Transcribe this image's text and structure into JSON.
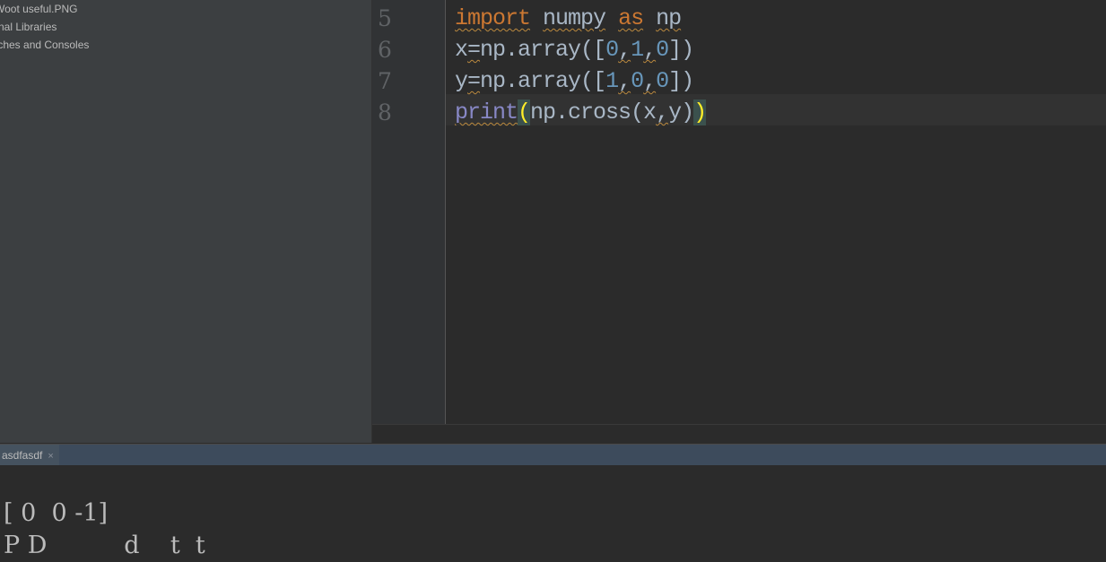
{
  "project_tree": {
    "items": [
      {
        "label": "Woot useful.PNG"
      },
      {
        "label": "rnal Libraries"
      },
      {
        "label": "tches and Consoles"
      }
    ]
  },
  "editor": {
    "line_numbers": [
      "5",
      "6",
      "7",
      "8"
    ],
    "lines": [
      {
        "kw_import": "import",
        "mod": "numpy",
        "kw_as": "as",
        "alias": "np"
      },
      {
        "var": "x",
        "eq": "=",
        "call": "np.array([",
        "n1": "0",
        "c1": ",",
        "n2": "1",
        "c2": ",",
        "n3": "0",
        "close": "])"
      },
      {
        "var": "y",
        "eq": "=",
        "call": "np.array([",
        "n1": "1",
        "c1": ",",
        "n2": "0",
        "c2": ",",
        "n3": "0",
        "close": "])"
      },
      {
        "fn": "print",
        "open": "(",
        "body": "np.cross(x",
        "comma": ",",
        "arg2": "y)",
        "close": ")"
      }
    ]
  },
  "run_panel": {
    "tab_label": "asdfasdf",
    "close_glyph": "×",
    "output_lines": [
      "[ 0  0 -1]",
      "P D          d    t  t  "
    ]
  },
  "colors": {
    "keyword": "#cc7832",
    "number": "#6897bb",
    "builtin": "#8888c6",
    "default_text": "#a9b7c6",
    "editor_bg": "#2b2b2b",
    "sidebar_bg": "#3c3f41"
  }
}
